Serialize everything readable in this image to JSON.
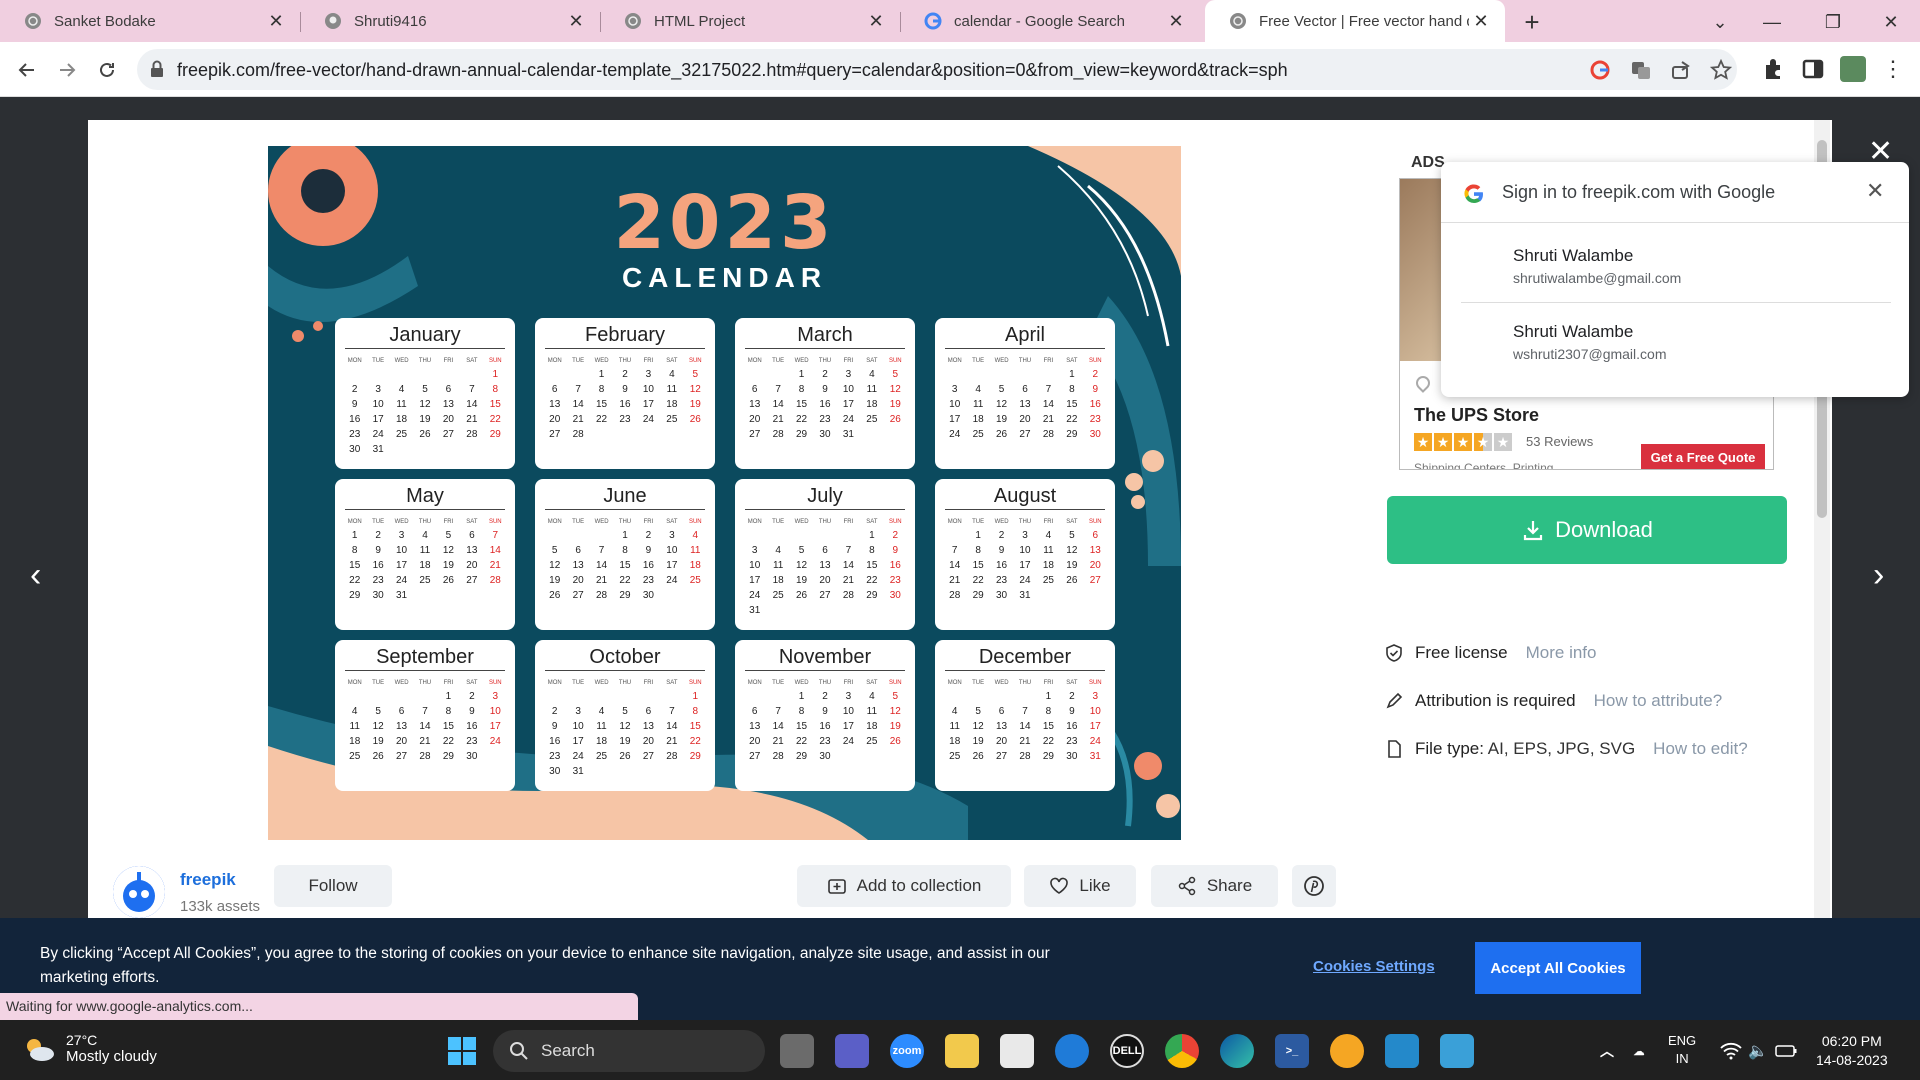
{
  "browser": {
    "tabs": [
      {
        "title": "Sanket Bodake",
        "icon": "globe-icon"
      },
      {
        "title": "Shruti9416",
        "icon": "github-icon"
      },
      {
        "title": "HTML Project",
        "icon": "globe-icon"
      },
      {
        "title": "calendar - Google Search",
        "icon": "google-icon"
      },
      {
        "title": "Free Vector | Free vector hand dr",
        "icon": "globe-icon",
        "active": true
      }
    ],
    "url": "freepik.com/free-vector/hand-drawn-annual-calendar-template_32175022.htm#query=calendar&position=0&from_view=keyword&track=sph",
    "status": "Waiting for www.google-analytics.com..."
  },
  "calendar": {
    "year": "2023",
    "title": "CALENDAR",
    "dow": [
      "MON",
      "TUE",
      "WED",
      "THU",
      "FRI",
      "SAT",
      "SUN"
    ],
    "months": [
      {
        "name": "January",
        "offset": 6,
        "days": 31
      },
      {
        "name": "February",
        "offset": 2,
        "days": 28
      },
      {
        "name": "March",
        "offset": 2,
        "days": 31
      },
      {
        "name": "April",
        "offset": 5,
        "days": 30
      },
      {
        "name": "May",
        "offset": 0,
        "days": 31
      },
      {
        "name": "June",
        "offset": 3,
        "days": 30
      },
      {
        "name": "July",
        "offset": 5,
        "days": 31
      },
      {
        "name": "August",
        "offset": 1,
        "days": 31
      },
      {
        "name": "September",
        "offset": 4,
        "days": 30
      },
      {
        "name": "October",
        "offset": 6,
        "days": 31
      },
      {
        "name": "November",
        "offset": 2,
        "days": 30
      },
      {
        "name": "December",
        "offset": 4,
        "days": 31
      }
    ]
  },
  "ad": {
    "label": "ADS",
    "name": "The UPS Store",
    "rating_of_5": 3.5,
    "reviews": "53 Reviews",
    "subtitle": "Shipping Centers, Printing...",
    "cta": "Get a Free Quote"
  },
  "google_signin": {
    "title": "Sign in to freepik.com with Google",
    "accounts": [
      {
        "name": "Shruti Walambe",
        "email": "shrutiwalambe@gmail.com"
      },
      {
        "name": "Shruti Walambe",
        "email": "wshruti2307@gmail.com"
      }
    ]
  },
  "resource": {
    "download_label": "Download",
    "license": "Free license",
    "license_link": "More info",
    "attribution": "Attribution is required",
    "attribution_link": "How to attribute?",
    "filetype_label": "File type:",
    "filetype_value": "AI, EPS, JPG, SVG",
    "filetype_link": "How to edit?"
  },
  "author": {
    "name": "freepik",
    "assets": "133k assets",
    "follow": "Follow"
  },
  "actions": {
    "add_collection": "Add to collection",
    "like": "Like",
    "share": "Share"
  },
  "cookies": {
    "text": "By clicking “Accept All Cookies”, you agree to the storing of cookies on your device to enhance site navigation, analyze site usage, and assist in our marketing efforts.",
    "settings": "Cookies Settings",
    "accept": "Accept All Cookies"
  },
  "taskbar": {
    "temp": "27°C",
    "condition": "Mostly cloudy",
    "search": "Search",
    "lang1": "ENG",
    "lang2": "IN",
    "time": "06:20 PM",
    "date": "14-08-2023"
  },
  "colors": {
    "download": "#2dbf85",
    "cookie_bg": "#12243a",
    "accept": "#1e6ff0",
    "calendar_bg": "#0b4a5e",
    "year": "#f5a47e"
  }
}
